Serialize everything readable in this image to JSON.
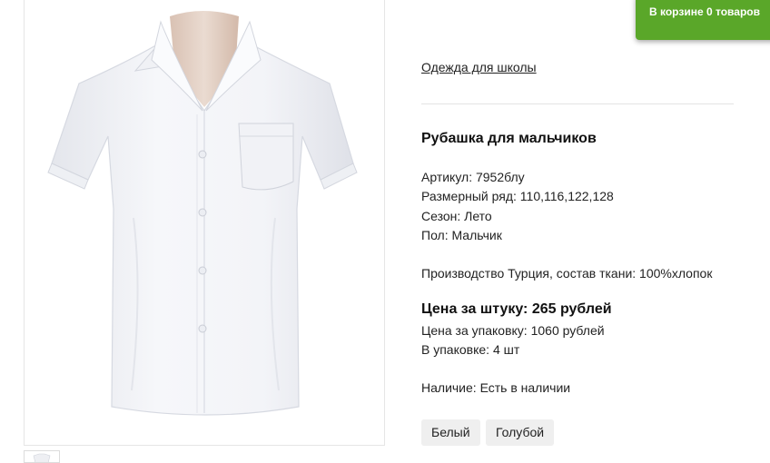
{
  "cart": {
    "prefix": "В корзине",
    "count": "0",
    "suffix": "товаров"
  },
  "product": {
    "category": "Одежда для школы",
    "title": "Рубашка для мальчиков",
    "article": "Артикул: 7952блу",
    "sizes": "Размерный ряд: 110,116,122,128",
    "season": "Сезон: Лето",
    "gender": "Пол: Мальчик",
    "origin": "Производство Турция, состав ткани: 100%хлопок",
    "price_unit": "Цена за штуку: 265 рублей",
    "price_pack": "Цена за упаковку: 1060 рублей",
    "pack_qty": "В упаковке: 4 шт",
    "availability": "Наличие: Есть в наличии",
    "colors": [
      "Белый",
      "Голубой"
    ]
  },
  "theme": {
    "accent": "#5aa729",
    "mannequin": "#e3cfc3"
  }
}
